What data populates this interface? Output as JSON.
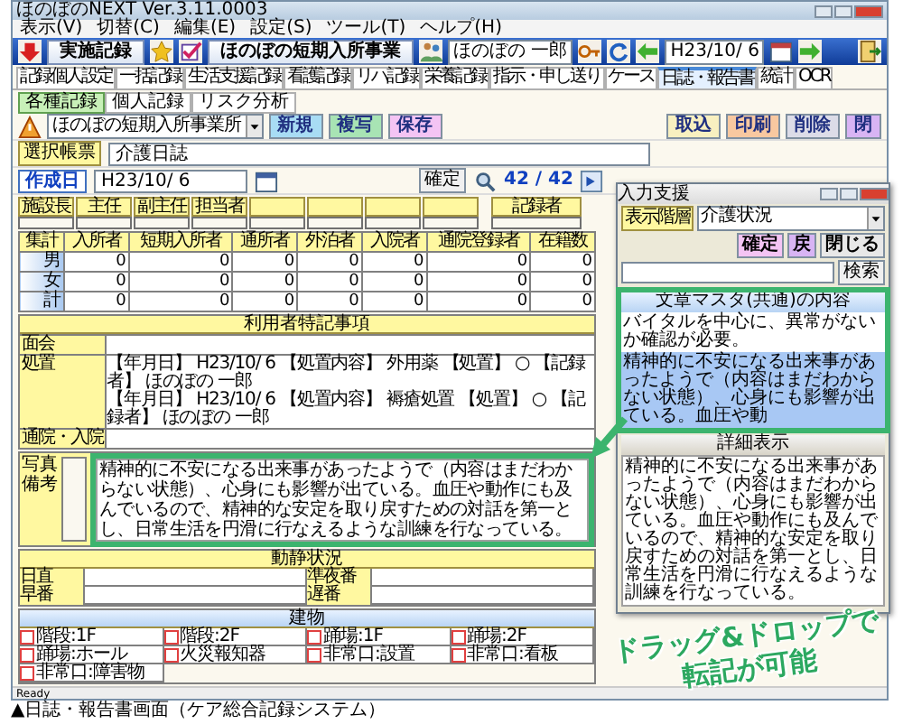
{
  "window": {
    "title": "ほのぼのNEXT Ver.3.11.0003"
  },
  "menu": [
    "表示(V)",
    "切替(C)",
    "編集(E)",
    "設定(S)",
    "ツール(T)",
    "ヘルプ(H)"
  ],
  "toolbar": {
    "mode": "実施記録",
    "office": "ほのぼの短期入所事業",
    "user": "ほのぼの 一郎",
    "date": "H23/10/ 6"
  },
  "tabs": [
    {
      "label": "記録個人設定",
      "selected": false
    },
    {
      "label": "一括記録",
      "selected": false
    },
    {
      "label": "生活支援記録",
      "selected": false
    },
    {
      "label": "看護記録",
      "selected": false
    },
    {
      "label": "リハ記録",
      "selected": false
    },
    {
      "label": "栄養記録",
      "selected": false
    },
    {
      "label": "指示・申し送り",
      "selected": false
    },
    {
      "label": "ケース",
      "selected": false
    },
    {
      "label": "日誌・報告書",
      "selected": true
    },
    {
      "label": "統計",
      "selected": false
    },
    {
      "label": "OCR",
      "selected": false
    }
  ],
  "subtabs": [
    {
      "label": "各種記録",
      "selected": true
    },
    {
      "label": "個人記録",
      "selected": false
    },
    {
      "label": "リスク分析",
      "selected": false
    }
  ],
  "actions": {
    "office_select": "ほのぼの短期入所事業所",
    "left_buttons": [
      {
        "label": "新規",
        "color": "#a8dcf4"
      },
      {
        "label": "複写",
        "color": "#a8e4b4"
      },
      {
        "label": "保存",
        "color": "#f4c4f4"
      }
    ],
    "right_buttons": [
      {
        "label": "取込",
        "color": "#f8f0c0"
      },
      {
        "label": "印刷",
        "color": "#f8c8a0"
      },
      {
        "label": "削除",
        "color": "#dcdce8"
      },
      {
        "label": "閉",
        "color": "#d8b4f4"
      }
    ]
  },
  "form": {
    "label": "選択帳票",
    "value": "介護日誌"
  },
  "created": {
    "label": "作成日",
    "value": "H23/10/ 6",
    "confirm": "確定",
    "page": "42 / 42"
  },
  "signers": {
    "columns": [
      "施設長",
      "主任",
      "副主任",
      "担当者"
    ],
    "recorder": "記録者"
  },
  "totals": {
    "columns": [
      "集計",
      "入所者",
      "短期入所者",
      "通所者",
      "外泊者",
      "入院者",
      "通院登録者",
      "在籍数"
    ],
    "rows": [
      {
        "label": "男",
        "values": [
          "0",
          "0",
          "0",
          "0",
          "0",
          "0",
          "0"
        ]
      },
      {
        "label": "女",
        "values": [
          "0",
          "0",
          "0",
          "0",
          "0",
          "0",
          "0"
        ]
      },
      {
        "label": "計",
        "values": [
          "0",
          "0",
          "0",
          "0",
          "0",
          "0",
          "0"
        ]
      }
    ]
  },
  "notes": {
    "title": "利用者特記事項",
    "rows": [
      {
        "label": "面会"
      },
      {
        "label": "処置",
        "lines": [
          "【年月日】 H23/10/ 6 【処置内容】 外用薬 【処置】 ○ 【記録者】 ほのぼの 一郎",
          "【年月日】 H23/10/ 6 【処置内容】 褥瘡処置 【処置】 ○ 【記録者】 ほのぼの 一郎"
        ]
      },
      {
        "label": "通院・入院"
      }
    ]
  },
  "remarks": {
    "label": "写真備考",
    "text": "精神的に不安になる出来事があったようで（内容はまだわからない状態）、心身にも影響が出ている。血圧や動作にも及んでいるので、精神的な安定を取り戻すための対話を第一とし、日常生活を円滑に行なえるような訓練を行なっている。"
  },
  "duty": {
    "title": "動静状況",
    "labels": [
      "日直",
      "準夜番",
      "早番",
      "遅番"
    ]
  },
  "building": {
    "title": "建物",
    "items": [
      {
        "label": "階段:1F",
        "checked": false
      },
      {
        "label": "階段:2F",
        "checked": false
      },
      {
        "label": "踊場:1F",
        "checked": false
      },
      {
        "label": "踊場:2F",
        "checked": false
      },
      {
        "label": "踊場:ホール",
        "checked": false
      },
      {
        "label": "火災報知器",
        "checked": false
      },
      {
        "label": "非常口:設置",
        "checked": false
      },
      {
        "label": "非常口:看板",
        "checked": false
      },
      {
        "label": "非常口:障害物",
        "checked": false
      }
    ]
  },
  "status_bar": "Ready",
  "popup": {
    "title": "入力支援",
    "level_button": "表示階層",
    "category": "介護状況",
    "buttons": [
      {
        "label": "確定",
        "color": "#f4c4f4"
      },
      {
        "label": "戻",
        "color": "#d8b4f4"
      },
      {
        "label": "閉じる",
        "color": "#e8e8e8"
      }
    ],
    "search_button": "検索",
    "list_title": "文章マスタ(共通)の内容",
    "items": [
      {
        "text": "バイタルを中心に、異常がないか確認が必要。",
        "selected": false
      },
      {
        "text": "精神的に不安になる出来事があったようで（内容はまだわからない状態）、心身にも影響が出ている。血圧や動",
        "selected": true
      }
    ],
    "detail_title": "詳細表示",
    "detail_text": "精神的に不安になる出来事があったようで（内容はまだわからない状態）、心身にも影響が出ている。血圧や動作にも及んでいるので、精神的な安定を取り戻すための対話を第一とし、日常生活を円滑に行なえるような訓練を行なっている。"
  },
  "annotation": [
    "ドラッグ&ドロップで",
    "転記が可能"
  ],
  "caption": "▲日誌・報告書画面（ケア総合記録システム）"
}
